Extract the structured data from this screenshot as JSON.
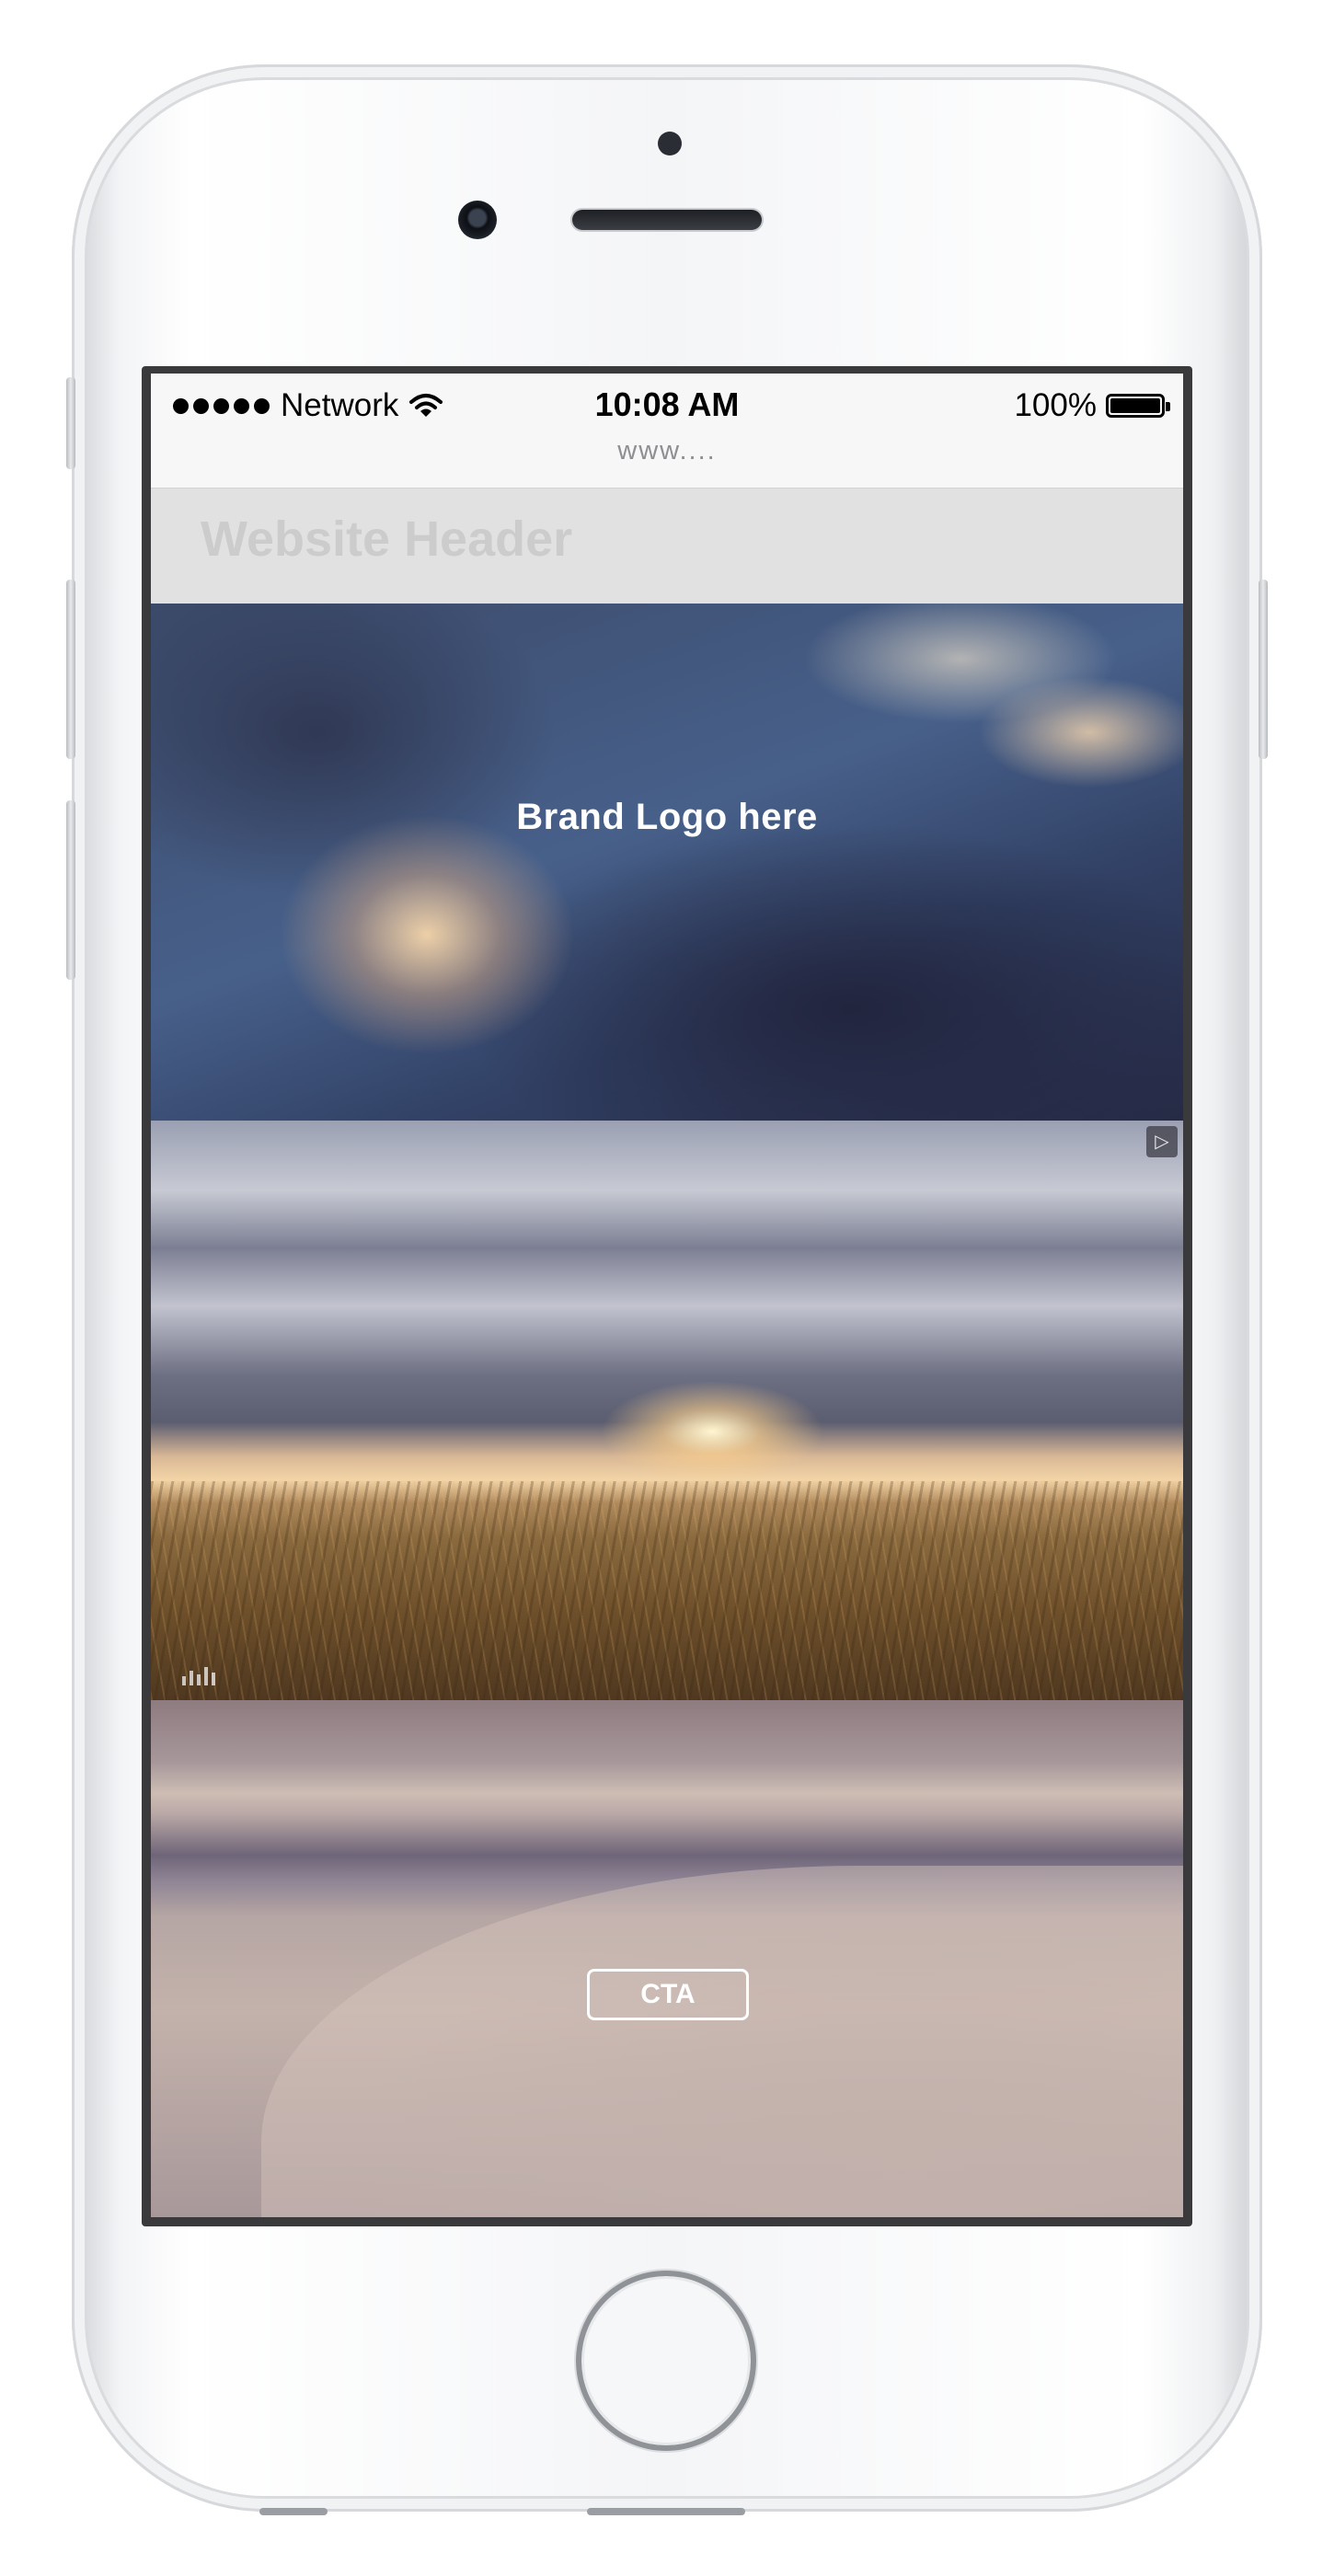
{
  "status_bar": {
    "carrier": "Network",
    "time": "10:08 AM",
    "battery": "100%",
    "signal_icon": "signal-dots-icon",
    "wifi_icon": "wifi-icon",
    "battery_icon": "battery-icon",
    "battery_level": 1.0
  },
  "browser": {
    "url": "www...."
  },
  "website": {
    "header_title": "Website Header",
    "hero_brand_text": "Brand Logo here",
    "cta_label": "CTA",
    "ad_icon": "ad-play-icon",
    "audio_icon": "audio-bars-icon"
  },
  "colors": {
    "header_bg": "#e1e1e1",
    "header_text": "#cccccc",
    "overlay_text": "#ffffff"
  }
}
